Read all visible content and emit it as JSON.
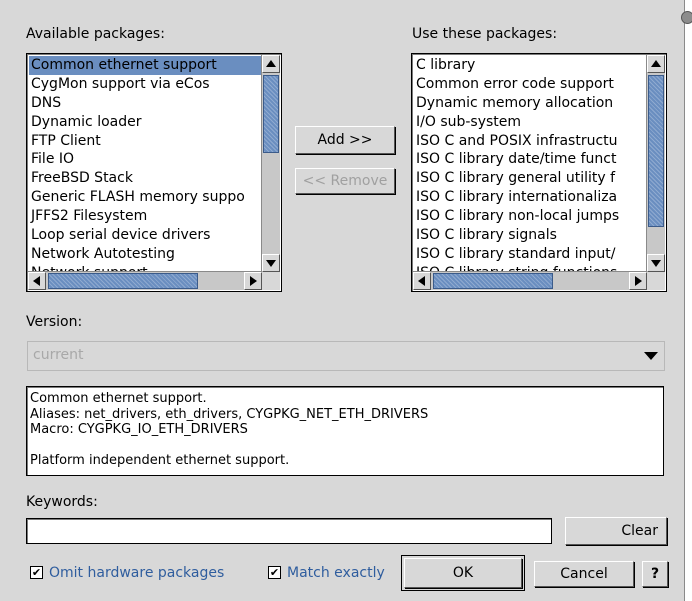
{
  "available": {
    "label": "Available packages:",
    "items": [
      "Common ethernet support",
      "CygMon support via eCos",
      "DNS",
      "Dynamic loader",
      "FTP Client",
      "File IO",
      "FreeBSD Stack",
      "Generic FLASH memory suppo",
      "JFFS2 Filesystem",
      "Loop serial device drivers",
      "Network Autotesting",
      "Network support"
    ],
    "selected_index": 0
  },
  "use": {
    "label": "Use these packages:",
    "items": [
      "C library",
      "Common error code support",
      "Dynamic memory allocation",
      "I/O sub-system",
      "ISO C and POSIX infrastructu",
      "ISO C library date/time funct",
      "ISO C library general utility f",
      "ISO C library internationaliza",
      "ISO C library non-local jumps",
      "ISO C library signals",
      "ISO C library standard input/",
      "ISO C library string functions"
    ]
  },
  "buttons": {
    "add": "Add >>",
    "remove": "<< Remove",
    "clear": "Clear",
    "ok": "OK",
    "cancel": "Cancel",
    "help": "?"
  },
  "version": {
    "label": "Version:",
    "value": "current"
  },
  "description": {
    "lines": [
      "Common ethernet support.",
      "Aliases: net_drivers, eth_drivers, CYGPKG_NET_ETH_DRIVERS",
      "Macro: CYGPKG_IO_ETH_DRIVERS",
      "",
      "Platform independent ethernet support."
    ]
  },
  "keywords": {
    "label": "Keywords:",
    "value": ""
  },
  "options": {
    "omit_hardware": "Omit hardware packages",
    "omit_hardware_checked": true,
    "match_exactly": "Match exactly",
    "match_exactly_checked": true,
    "check_glyph": "✔"
  },
  "icons": {
    "up": "arrow-up-icon",
    "down": "arrow-down-icon",
    "left": "arrow-left-icon",
    "right": "arrow-right-icon",
    "dropdown": "chevron-down-icon"
  }
}
